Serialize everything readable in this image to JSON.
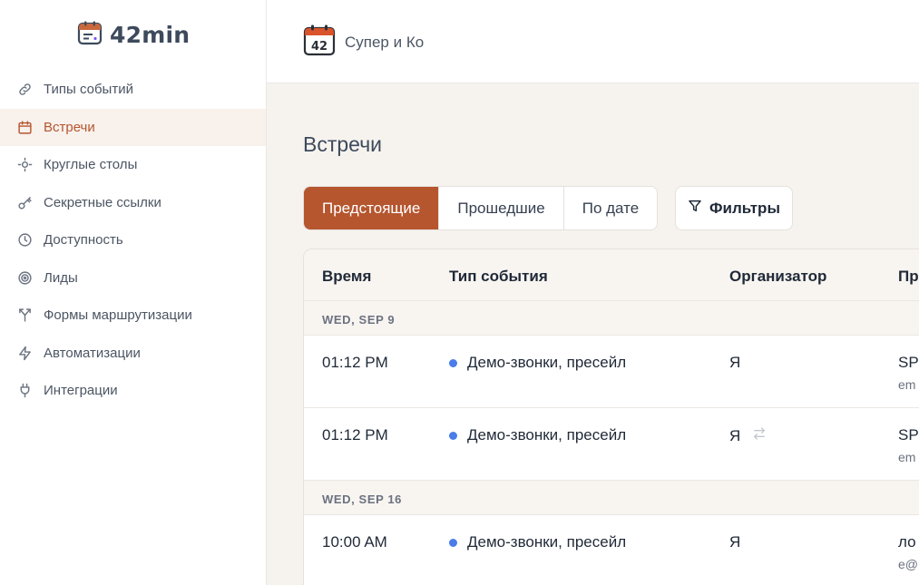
{
  "app": {
    "name": "42min"
  },
  "sidebar": {
    "items": [
      {
        "label": "Типы событий",
        "icon": "link-icon",
        "active": false
      },
      {
        "label": "Встречи",
        "icon": "calendar-icon",
        "active": true
      },
      {
        "label": "Круглые столы",
        "icon": "round-table-icon",
        "active": false
      },
      {
        "label": "Секретные ссылки",
        "icon": "key-icon",
        "active": false
      },
      {
        "label": "Доступность",
        "icon": "clock-icon",
        "active": false
      },
      {
        "label": "Лиды",
        "icon": "target-icon",
        "active": false
      },
      {
        "label": "Формы маршрутизации",
        "icon": "routing-icon",
        "active": false
      },
      {
        "label": "Автоматизации",
        "icon": "lightning-icon",
        "active": false
      },
      {
        "label": "Интеграции",
        "icon": "plug-icon",
        "active": false
      }
    ]
  },
  "header": {
    "org_name": "Супер и Ко",
    "org_badge": "42"
  },
  "main": {
    "title": "Встречи",
    "tabs": [
      {
        "label": "Предстоящие",
        "active": true
      },
      {
        "label": "Прошедшие",
        "active": false
      },
      {
        "label": "По дате",
        "active": false
      }
    ],
    "filter_label": "Фильтры"
  },
  "table": {
    "columns": [
      "Время",
      "Тип события",
      "Организатор",
      "Пр"
    ],
    "groups": [
      {
        "date": "WED, SEP 9",
        "rows": [
          {
            "time": "01:12 PM",
            "event_type": "Демо-звонки, пресейл",
            "organizer": "Я",
            "transfer": false,
            "participant": "SPI",
            "participant_sub": "em"
          },
          {
            "time": "01:12 PM",
            "event_type": "Демо-звонки, пресейл",
            "organizer": "Я",
            "transfer": true,
            "participant": "SPI",
            "participant_sub": "em"
          }
        ]
      },
      {
        "date": "WED, SEP 16",
        "rows": [
          {
            "time": "10:00 AM",
            "event_type": "Демо-звонки, пресейл",
            "organizer": "Я",
            "transfer": false,
            "participant": "ло",
            "participant_sub": "e@"
          }
        ]
      }
    ]
  },
  "colors": {
    "accent": "#b5562f",
    "dot": "#4a7de8",
    "bg": "#f6f3ef"
  }
}
